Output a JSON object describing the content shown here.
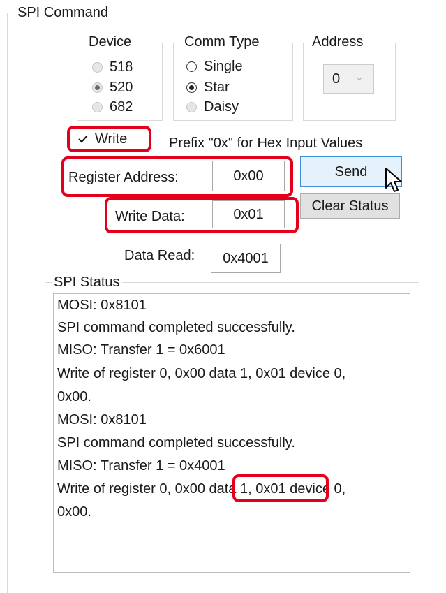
{
  "spi_command": {
    "title": "SPI Command",
    "device": {
      "title": "Device",
      "options": [
        "518",
        "520",
        "682"
      ],
      "selected": "520"
    },
    "comm_type": {
      "title": "Comm Type",
      "options": [
        "Single",
        "Star",
        "Daisy"
      ],
      "selected": "Star"
    },
    "address": {
      "title": "Address",
      "value": "0"
    },
    "write_checkbox": {
      "label": "Write",
      "checked": true
    },
    "prefix_hint": "Prefix \"0x\" for Hex Input Values",
    "register_address": {
      "label": "Register Address:",
      "value": "0x00"
    },
    "write_data": {
      "label": "Write Data:",
      "value": "0x01"
    },
    "data_read": {
      "label": "Data Read:",
      "value": "0x4001"
    },
    "send_label": "Send",
    "clear_status_label": "Clear Status"
  },
  "spi_status": {
    "title": "SPI Status",
    "lines": [
      "MOSI: 0x8101",
      "SPI command completed successfully.",
      "MISO: Transfer 1 = 0x6001",
      "Write of register 0, 0x00 data 1, 0x01 device 0,",
      "0x00.",
      "MOSI: 0x8101",
      "SPI command completed successfully.",
      "MISO: Transfer 1 = 0x4001",
      "Write of register 0, 0x00 data 1, 0x01 device 0,",
      "0x00."
    ]
  },
  "colors": {
    "highlight": "#e4001b",
    "send_accent": "#3c8fd9"
  }
}
